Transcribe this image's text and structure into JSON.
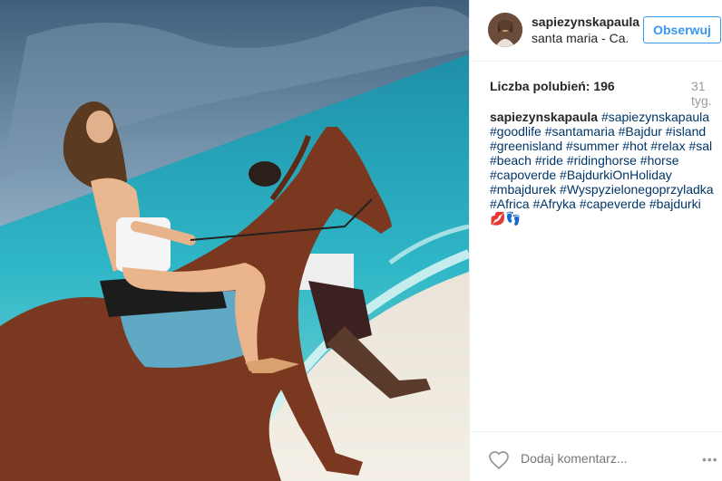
{
  "post": {
    "username": "sapiezynskapaula",
    "location": "santa maria - Ca...",
    "follow_label": "Obserwuj",
    "likes_label": "Liczba polubień: 196",
    "time_label": "31 tyg.",
    "caption_author": "sapiezynskapaula",
    "caption_tags": "#sapiezynskapaula #goodlife #santamaria #Bajdur #island #greenisland #summer #hot #relax #sal #beach #ride #ridinghorse #horse #capoverde #BajdurkiOnHoliday #mbajdurek #Wyspyzielonegoprzyladka #Africa #Afryka #capeverde #bajdurki",
    "caption_emoji": "💋👣",
    "comment_placeholder": "Dodaj komentarz...",
    "more_label": "•••"
  },
  "icons": {
    "heart": "heart-outline-icon",
    "more": "more-options-icon"
  },
  "colors": {
    "link": "#003569",
    "follow_blue": "#3897f0",
    "meta_gray": "#999999"
  }
}
